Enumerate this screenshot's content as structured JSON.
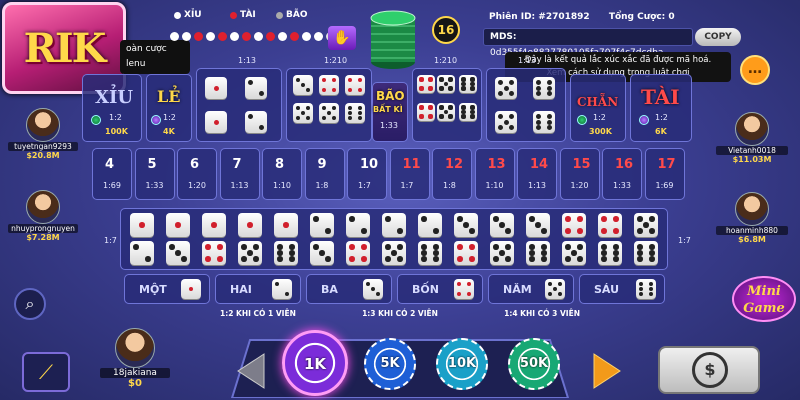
{
  "logo": {
    "text": "RIK"
  },
  "tooltip_left": {
    "line1": "oàn cược",
    "line2": "lenu"
  },
  "history": {
    "legend": [
      {
        "label": "XỈU",
        "color": "#ffffff"
      },
      {
        "label": "TÀI",
        "color": "#e0202e"
      },
      {
        "label": "BÃO",
        "color": "#aaaaaa"
      }
    ]
  },
  "timer": {
    "value": "16"
  },
  "info": {
    "phien_label": "Phiên ID:",
    "phien_value": "#2701892",
    "tong_label": "Tổng Cược:",
    "tong_value": "0",
    "mds_label": "MDS:",
    "mds_value": "0d355f4e8827780105fa707f4c7dcdba",
    "copy_label": "COPY"
  },
  "tooltip_right": {
    "line1": "Đây là kết quả lắc xúc xắc đã được mã hoá.",
    "line2": "Xem cách sử dụng trong luật chơi"
  },
  "bets": {
    "xiu": {
      "label": "XỈU",
      "odds": "1:2",
      "amount": "100K"
    },
    "le": {
      "label": "LẺ",
      "odds": "1:2",
      "amount": "4K"
    },
    "triple_odds": "1:13",
    "any_triple": {
      "line1": "BÃO",
      "line2": "BẤT KÌ",
      "odds": "1:33"
    },
    "double_odds": "1:210",
    "chan": {
      "label": "CHẴN",
      "odds": "1:2",
      "amount": "300K"
    },
    "tai": {
      "label": "TÀI",
      "odds": "1:2",
      "amount": "6K"
    }
  },
  "sums": [
    {
      "n": "4",
      "o": "1:69"
    },
    {
      "n": "5",
      "o": "1:33"
    },
    {
      "n": "6",
      "o": "1:20"
    },
    {
      "n": "7",
      "o": "1:13"
    },
    {
      "n": "8",
      "o": "1:10"
    },
    {
      "n": "9",
      "o": "1:8"
    },
    {
      "n": "10",
      "o": "1:7"
    },
    {
      "n": "11",
      "o": "1:7"
    },
    {
      "n": "12",
      "o": "1:8"
    },
    {
      "n": "13",
      "o": "1:10"
    },
    {
      "n": "14",
      "o": "1:13"
    },
    {
      "n": "15",
      "o": "1:20"
    },
    {
      "n": "16",
      "o": "1:33"
    },
    {
      "n": "17",
      "o": "1:69"
    }
  ],
  "combo_odds_left": "1:7",
  "combo_odds_right": "1:7",
  "singles": [
    {
      "label": "MỘT"
    },
    {
      "label": "HAI"
    },
    {
      "label": "BA"
    },
    {
      "label": "BỐN"
    },
    {
      "label": "NĂM"
    },
    {
      "label": "SÁU"
    }
  ],
  "rules": {
    "r1": "1:2 KHI CÓ 1 VIÊN",
    "r2": "1:3 KHI CÓ 2 VIÊN",
    "r3": "1:4 KHI CÓ 3 VIÊN"
  },
  "players": {
    "p1": {
      "name": "tuyetngan9293",
      "money": "$20.8M"
    },
    "p2": {
      "name": "nhuyprongnuyen",
      "money": "$7.28M"
    },
    "p3": {
      "name": "Vietanh0018",
      "money": "$11.03M"
    },
    "p4": {
      "name": "hoanminh880",
      "money": "$6.8M"
    },
    "self": {
      "name": "18jakiana",
      "money": "$0"
    }
  },
  "chips": [
    {
      "label": "1K",
      "color": "#7b2cd9"
    },
    {
      "label": "5K",
      "color": "#1e5fd6"
    },
    {
      "label": "10K",
      "color": "#1aa0c8"
    },
    {
      "label": "50K",
      "color": "#18a874"
    }
  ],
  "minigame": {
    "line1": "Mini",
    "line2": "Game"
  },
  "icons": {
    "rebet": "dollar-cycle-icon",
    "search": "search-icon",
    "stats": "chart-icon",
    "chat": "chat-icon"
  }
}
